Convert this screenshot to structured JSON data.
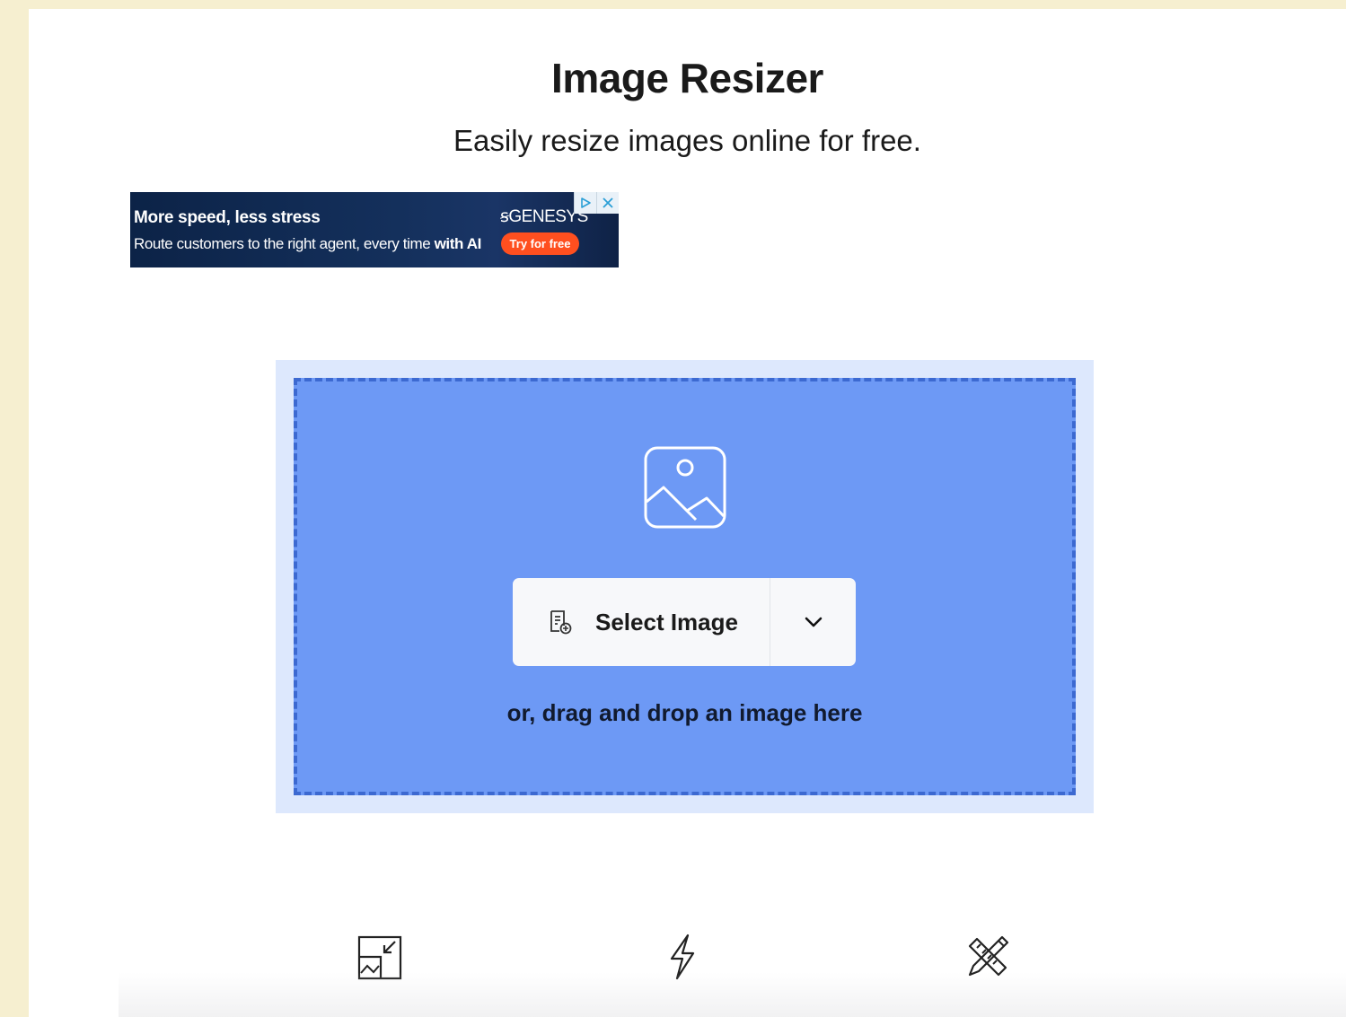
{
  "header": {
    "title": "Image Resizer",
    "subtitle": "Easily resize images online for free."
  },
  "ad": {
    "headline": "More speed, less stress",
    "body_prefix": "Route customers to the right agent, every time",
    "body_bold": "with AI",
    "brand": "GENESYS",
    "cta_label": "Try for free",
    "adchoices_icon": "adchoices-icon",
    "close_icon": "close-icon",
    "colors": {
      "background": "#0c2347",
      "accent": "#ff4f1f"
    }
  },
  "dropzone": {
    "icon": "image-icon",
    "select_button_label": "Select Image",
    "select_button_icon": "file-add-icon",
    "dropdown_icon": "chevron-down-icon",
    "drag_text": "or, drag and drop an image here",
    "colors": {
      "background": "#6d99f5",
      "outer": "#dde8fd",
      "border": "#3c69d1"
    }
  },
  "features": [
    {
      "icon": "resize-image-icon"
    },
    {
      "icon": "lightning-icon"
    },
    {
      "icon": "pencil-ruler-icon"
    }
  ]
}
